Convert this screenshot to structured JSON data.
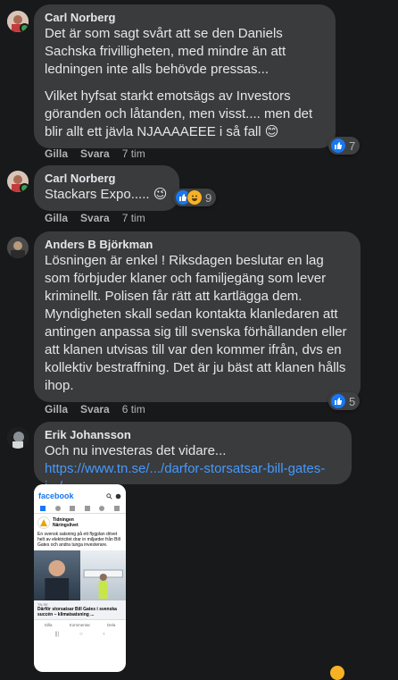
{
  "comments": [
    {
      "author": "Carl Norberg",
      "paragraphs": [
        "Det är som sagt svårt att se den Daniels Sachska frivilligheten, med mindre än att ledningen inte alls behövde pressas...",
        "Vilket hyfsat starkt emotsägs av Investors göranden och låtanden, men visst.... men det blir allt ett jävla NJAAAAEEE i så fall 😊"
      ],
      "reaction_count": "7",
      "like_label": "Gilla",
      "reply_label": "Svara",
      "time": "7 tim"
    },
    {
      "author": "Carl Norberg",
      "text": "Stackars Expo..... 😉",
      "reaction_count": "9",
      "like_label": "Gilla",
      "reply_label": "Svara",
      "time": "7 tim"
    },
    {
      "author": "Anders B Björkman",
      "text": "Lösningen är enkel ! Riksdagen beslutar en lag som förbjuder klaner och familjegäng som lever kriminellt. Polisen får rätt att kartlägga dem. Myndigheten skall sedan kontakta klanledaren att antingen anpassa sig till svenska förhållanden eller att klanen utvisas till var den kommer ifrån, dvs en kollektiv bestraffning. Det är ju bäst att klanen hålls ihop.",
      "reaction_count": "5",
      "like_label": "Gilla",
      "reply_label": "Svara",
      "time": "6 tim"
    },
    {
      "author": "Erik Johansson",
      "text": "Och nu investeras det vidare...",
      "link": "https://www.tn.se/.../darfor-storsatsar-bill-gates-i.../"
    }
  ],
  "screenshot": {
    "app_name": "facebook",
    "page_name_line1": "Tidningen",
    "page_name_line2": "Näringslivet",
    "post_text": "En svensk satsning på ett flygplan drivet helt av elektricitet drar in miljarder från Bill Gates och andra tunga investerare.",
    "source": "TN.SE",
    "headline": "Därför storsatsar Bill Gates i svenska succén – klimatsatsning ...",
    "like": "Gilla",
    "comment": "Kommentar",
    "share": "Dela"
  },
  "colors": {
    "background": "#18191a",
    "bubble": "#3a3b3c",
    "link": "#4599ff",
    "like_blue": "#1877f2",
    "online_green": "#31a24c"
  }
}
